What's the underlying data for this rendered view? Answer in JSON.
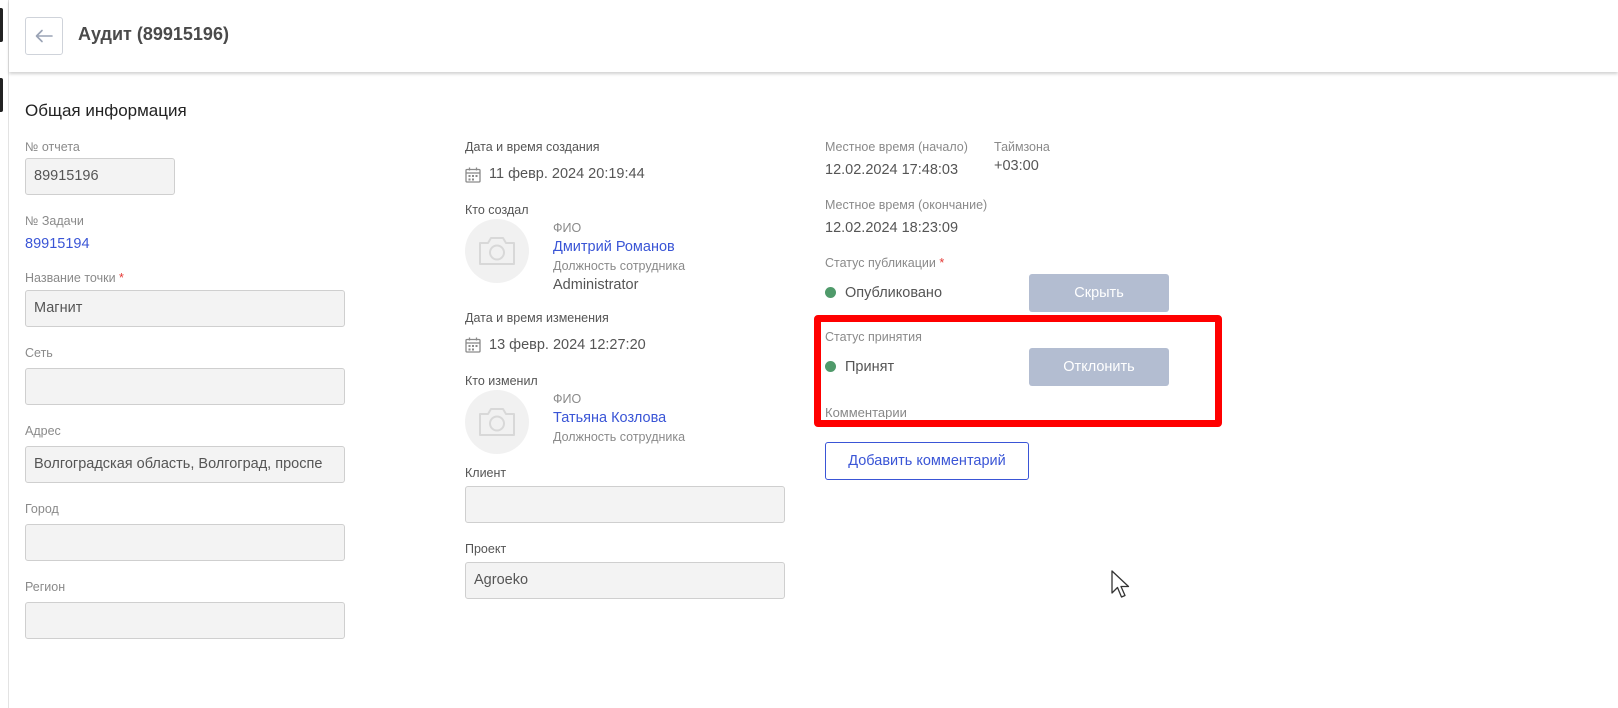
{
  "header": {
    "title": "Аудит (89915196)"
  },
  "section": {
    "title": "Общая информация"
  },
  "col1": {
    "report_no_label": "№ отчета",
    "report_no_value": "89915196",
    "task_no_label": "№ Задачи",
    "task_no_value": "89915194",
    "point_label": "Название точки",
    "point_value": "Магнит",
    "network_label": "Сеть",
    "network_value": "",
    "address_label": "Адрес",
    "address_value": "Волгоградская область, Волгоград, проспе",
    "city_label": "Город",
    "city_value": "",
    "region_label": "Регион",
    "region_value": ""
  },
  "col2": {
    "created_label": "Дата и время создания",
    "created_value": "11 февр. 2024 20:19:44",
    "creator_label": "Кто создал",
    "creator_fio_label": "ФИО",
    "creator_name": "Дмитрий Романов",
    "creator_position_label": "Должность сотрудника",
    "creator_position": "Administrator",
    "modified_label": "Дата и время изменения",
    "modified_value": "13 февр. 2024 12:27:20",
    "modifier_label": "Кто изменил",
    "modifier_fio_label": "ФИО",
    "modifier_name": "Татьяна Козлова",
    "modifier_position_label": "Должность сотрудника",
    "client_label": "Клиент",
    "client_value": "",
    "project_label": "Проект",
    "project_value": "Agroeko"
  },
  "col3": {
    "local_start_label": "Местное время (начало)",
    "local_start_value": "12.02.2024 17:48:03",
    "timezone_label": "Таймзона",
    "timezone_value": "+03:00",
    "local_end_label": "Местное время (окончание)",
    "local_end_value": "12.02.2024 18:23:09",
    "publication_label": "Статус публикации",
    "publication_value": "Опубликовано",
    "hide_button": "Скрыть",
    "acceptance_label": "Статус принятия",
    "acceptance_value": "Принят",
    "reject_button": "Отклонить",
    "comments_label": "Комментарии",
    "add_comment_button": "Добавить комментарий"
  },
  "colors": {
    "link": "#3a55d6",
    "status_dot": "#4f9a6a",
    "disabled_button": "#b3bdd1",
    "highlight": "#ff0000",
    "required": "#e53935"
  }
}
